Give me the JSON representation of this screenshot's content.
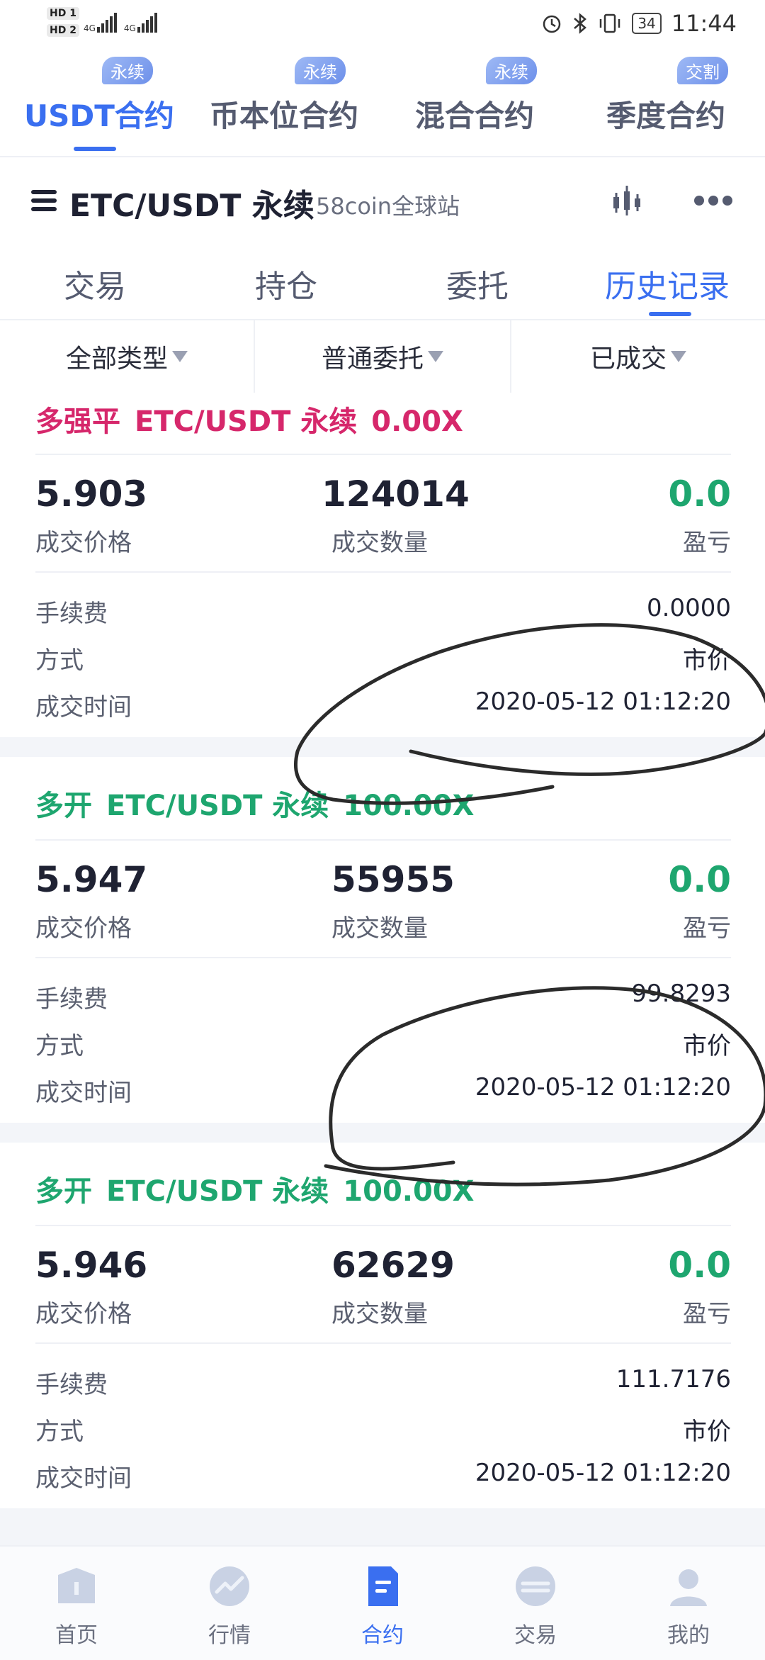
{
  "status_bar": {
    "hd1": "HD 1",
    "hd2": "HD 2",
    "net1": "4G",
    "net2": "4G",
    "battery": "34",
    "time": "11:44"
  },
  "top_tabs": [
    {
      "label": "USDT合约",
      "badge": "永续",
      "active": true
    },
    {
      "label": "币本位合约",
      "badge": "永续",
      "active": false
    },
    {
      "label": "混合合约",
      "badge": "永续",
      "active": false
    },
    {
      "label": "季度合约",
      "badge": "交割",
      "active": false
    }
  ],
  "header": {
    "pair": "ETC/USDT 永续",
    "site": "58coin全球站"
  },
  "sub_tabs": [
    {
      "label": "交易",
      "active": false
    },
    {
      "label": "持仓",
      "active": false
    },
    {
      "label": "委托",
      "active": false
    },
    {
      "label": "历史记录",
      "active": true
    }
  ],
  "filters": [
    "全部类型",
    "普通委托",
    "已成交"
  ],
  "records": [
    {
      "side": "多强平",
      "pair": "ETC/USDT 永续",
      "leverage": "0.00X",
      "price": "5.903",
      "qty": "124014",
      "pnl": "0.0",
      "price_label": "成交价格",
      "qty_label": "成交数量",
      "pnl_label": "盈亏",
      "fee_label": "手续费",
      "fee": "0.0000",
      "method_label": "方式",
      "method": "市价",
      "time_label": "成交时间",
      "time": "2020-05-12 01:12:20",
      "color": "#d6276b"
    },
    {
      "side": "多开",
      "pair": "ETC/USDT 永续",
      "leverage": "100.00X",
      "price": "5.947",
      "qty": "55955",
      "pnl": "0.0",
      "price_label": "成交价格",
      "qty_label": "成交数量",
      "pnl_label": "盈亏",
      "fee_label": "手续费",
      "fee": "99.8293",
      "method_label": "方式",
      "method": "市价",
      "time_label": "成交时间",
      "time": "2020-05-12 01:12:20",
      "color": "#1ea66f"
    },
    {
      "side": "多开",
      "pair": "ETC/USDT 永续",
      "leverage": "100.00X",
      "price": "5.946",
      "qty": "62629",
      "pnl": "0.0",
      "price_label": "成交价格",
      "qty_label": "成交数量",
      "pnl_label": "盈亏",
      "fee_label": "手续费",
      "fee": "111.7176",
      "method_label": "方式",
      "method": "市价",
      "time_label": "成交时间",
      "time": "2020-05-12 01:12:20",
      "color": "#1ea66f"
    }
  ],
  "bottom_nav": [
    {
      "label": "首页",
      "icon": "home-icon",
      "active": false
    },
    {
      "label": "行情",
      "icon": "market-icon",
      "active": false
    },
    {
      "label": "合约",
      "icon": "contract-icon",
      "active": true
    },
    {
      "label": "交易",
      "icon": "trade-icon",
      "active": false
    },
    {
      "label": "我的",
      "icon": "profile-icon",
      "active": false
    }
  ],
  "colors": {
    "accent": "#3a6ff0",
    "long_green": "#1ea66f",
    "liquidation_pink": "#d6276b"
  }
}
